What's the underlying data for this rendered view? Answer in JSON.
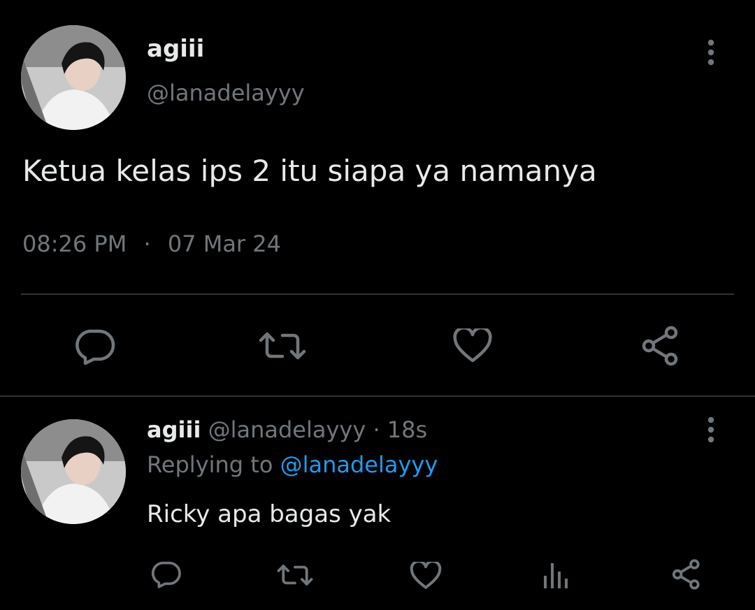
{
  "main_tweet": {
    "display_name": "agiii",
    "handle": "@lanadelayyy",
    "text": "Ketua kelas ips 2 itu siapa ya namanya",
    "time": "08:26 PM",
    "separator": "·",
    "date": "07 Mar 24",
    "avatar_icon": "profile-photo",
    "actions": [
      "reply-icon",
      "retweet-icon",
      "like-icon",
      "share-icon"
    ]
  },
  "reply_tweet": {
    "display_name": "agiii",
    "handle": "@lanadelayyy",
    "dot": "·",
    "age": "18s",
    "replying_prefix": "Replying to",
    "replying_to": "@lanadelayyy",
    "text": "Ricky apa bagas yak",
    "avatar_icon": "profile-photo",
    "actions": [
      "reply-icon",
      "retweet-icon",
      "like-icon",
      "views-icon",
      "share-icon"
    ]
  },
  "colors": {
    "background": "#000000",
    "text": "#e7e9ea",
    "muted": "#71767b",
    "link": "#1d9bf0",
    "divider": "#2f3336"
  }
}
